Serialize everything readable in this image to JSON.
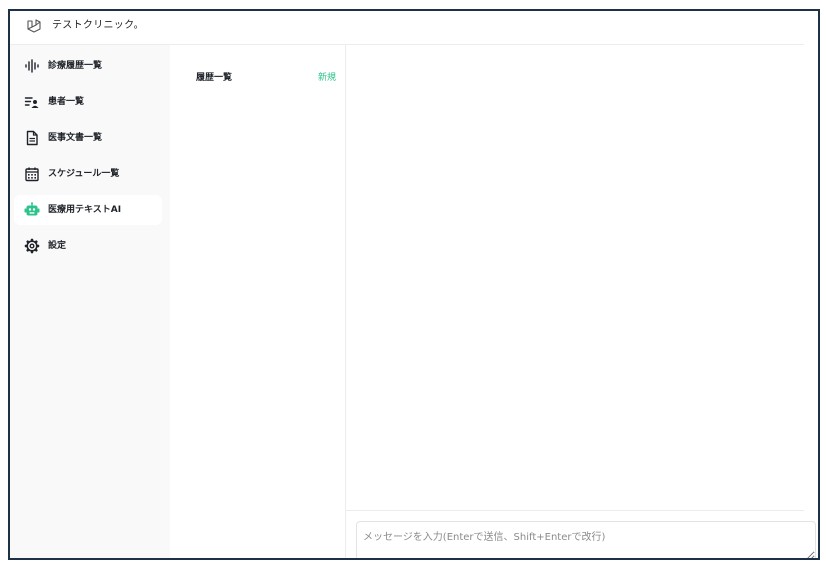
{
  "app": {
    "title": "テストクリニック。"
  },
  "sidebar": {
    "items": [
      {
        "label": "診療履歴一覧",
        "icon": "waveform-icon"
      },
      {
        "label": "患者一覧",
        "icon": "patient-list-icon"
      },
      {
        "label": "医事文書一覧",
        "icon": "document-icon"
      },
      {
        "label": "スケジュール一覧",
        "icon": "calendar-icon"
      },
      {
        "label": "医療用テキストAI",
        "icon": "robot-icon",
        "active": true
      },
      {
        "label": "設定",
        "icon": "gear-icon"
      }
    ]
  },
  "history": {
    "title": "履歴一覧",
    "new_label": "新規"
  },
  "chat": {
    "input_placeholder": "メッセージを入力(Enterで送信、Shift+Enterで改行)"
  },
  "colors": {
    "accent": "#2ec38c",
    "sidebar_bg": "#f9f9f9",
    "frame_border": "#1e3247"
  }
}
